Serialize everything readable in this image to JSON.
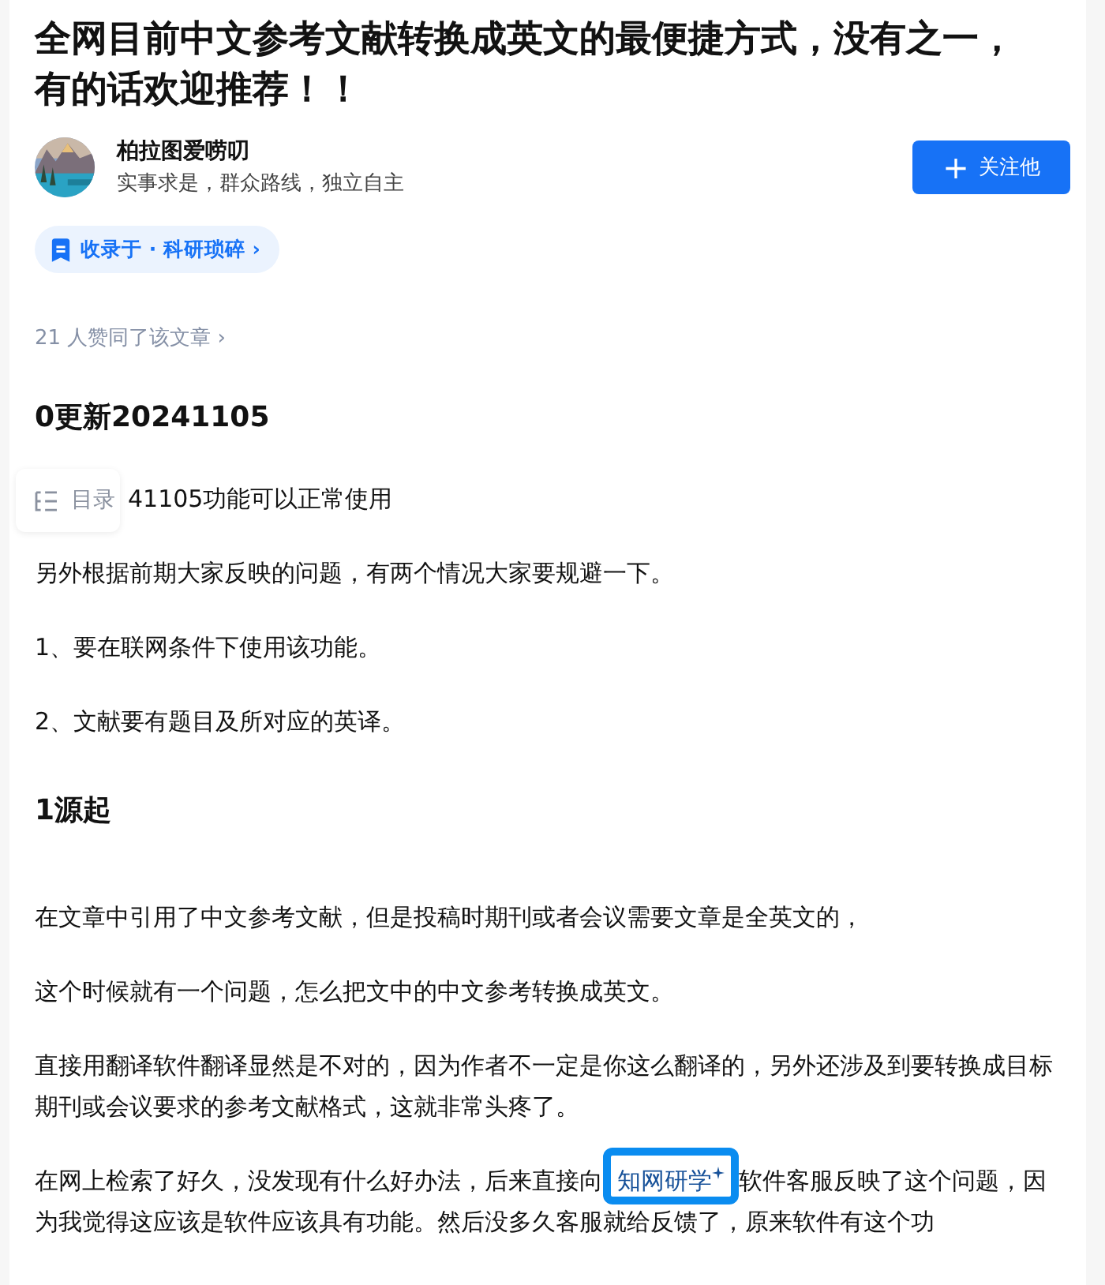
{
  "title": "全网目前中文参考文献转换成英文的最便捷方式，没有之一，有的话欢迎推荐！！",
  "author": {
    "name": "柏拉图爱唠叨",
    "bio": "实事求是，群众路线，独立自主"
  },
  "follow_button": {
    "icon": "+",
    "label": "关注他"
  },
  "collection": {
    "label": "收录于 · 科研琐碎 ›"
  },
  "likes": "21 人赞同了该文章 ›",
  "toc": {
    "label": "目录"
  },
  "blocks": [
    {
      "kind": "heading",
      "text": "0更新20241105"
    },
    {
      "kind": "partial",
      "text": "41105功能可以正常使用"
    },
    {
      "kind": "paragraph",
      "text": "另外根据前期大家反映的问题，有两个情况大家要规避一下。"
    },
    {
      "kind": "paragraph",
      "text": "1、要在联网条件下使用该功能。"
    },
    {
      "kind": "paragraph",
      "text": "2、文献要有题目及所对应的英译。"
    },
    {
      "kind": "heading",
      "text": "1源起"
    },
    {
      "kind": "paragraph",
      "text": "在文章中引用了中文参考文献，但是投稿时期刊或者会议需要文章是全英文的，"
    },
    {
      "kind": "paragraph",
      "text": "这个时候就有一个问题，怎么把文中的中文参考转换成英文。"
    },
    {
      "kind": "paragraph",
      "text": "直接用翻译软件翻译显然是不对的，因为作者不一定是你这么翻译的，另外还涉及到要转换成目标期刊或会议要求的参考文献格式，这就非常头疼了。"
    },
    {
      "kind": "linked",
      "before": "在网上检索了好久，没发现有什么好办法，后来直接向",
      "link": "知网研学",
      "after": "软件客服反映了这个问题，因为我觉得这应该是软件应该具有功能。然后没多久客服就给反馈了，原来软件有这个功"
    }
  ]
}
